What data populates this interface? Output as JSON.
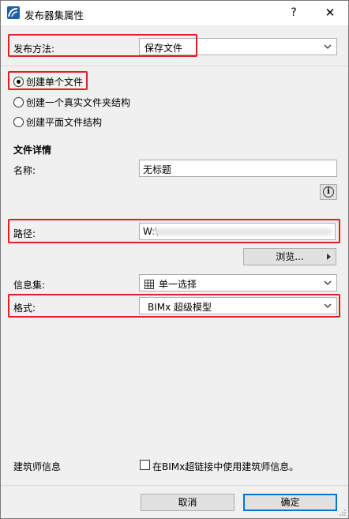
{
  "window": {
    "title": "发布器集属性",
    "help_label": "?",
    "close_label": "✕"
  },
  "publish_method": {
    "label": "发布方法:",
    "value": "保存文件"
  },
  "options": [
    {
      "label": "创建单个文件",
      "selected": true
    },
    {
      "label": "创建一个真实文件夹结构",
      "selected": false
    },
    {
      "label": "创建平面文件结构",
      "selected": false
    }
  ],
  "file_details": {
    "heading": "文件详情",
    "name_label": "名称:",
    "name_value": "无标题",
    "info_icon": "info-icon"
  },
  "path": {
    "label": "路径:",
    "value": "W:\\"
  },
  "browse": {
    "label": "浏览..."
  },
  "info_set": {
    "label": "信息集:",
    "value": "单一选择",
    "icon": "grid-icon"
  },
  "format": {
    "label": "格式:",
    "value": "BIMx 超级模型"
  },
  "architect": {
    "label": "建筑师信息",
    "checkbox_label": "在BIMx超链接中使用建筑师信息。",
    "checked": false
  },
  "footer": {
    "cancel_label": "取消",
    "ok_label": "确定"
  },
  "colors": {
    "highlight": "#e02020",
    "primary_border": "#0078d7",
    "app_icon": "#1f5fa8"
  }
}
